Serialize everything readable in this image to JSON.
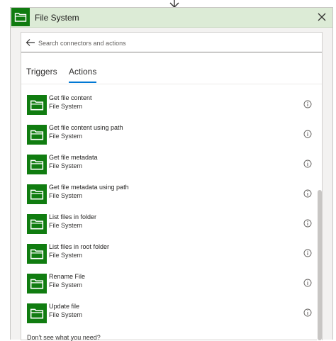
{
  "header": {
    "title": "File System",
    "icon": "folder-icon"
  },
  "search": {
    "placeholder": "Search connectors and actions"
  },
  "tabs": [
    {
      "label": "Triggers",
      "active": false
    },
    {
      "label": "Actions",
      "active": true
    }
  ],
  "actions": [
    {
      "title": "Get file content",
      "connector": "File System"
    },
    {
      "title": "Get file content using path",
      "connector": "File System"
    },
    {
      "title": "Get file metadata",
      "connector": "File System"
    },
    {
      "title": "Get file metadata using path",
      "connector": "File System"
    },
    {
      "title": "List files in folder",
      "connector": "File System"
    },
    {
      "title": "List files in root folder",
      "connector": "File System"
    },
    {
      "title": "Rename File",
      "connector": "File System"
    },
    {
      "title": "Update file",
      "connector": "File System"
    }
  ],
  "footer": {
    "text": "Don't see what you need?"
  },
  "colors": {
    "brand": "#107c10",
    "header_bg": "#dcebd6",
    "accent": "#0078d4"
  }
}
